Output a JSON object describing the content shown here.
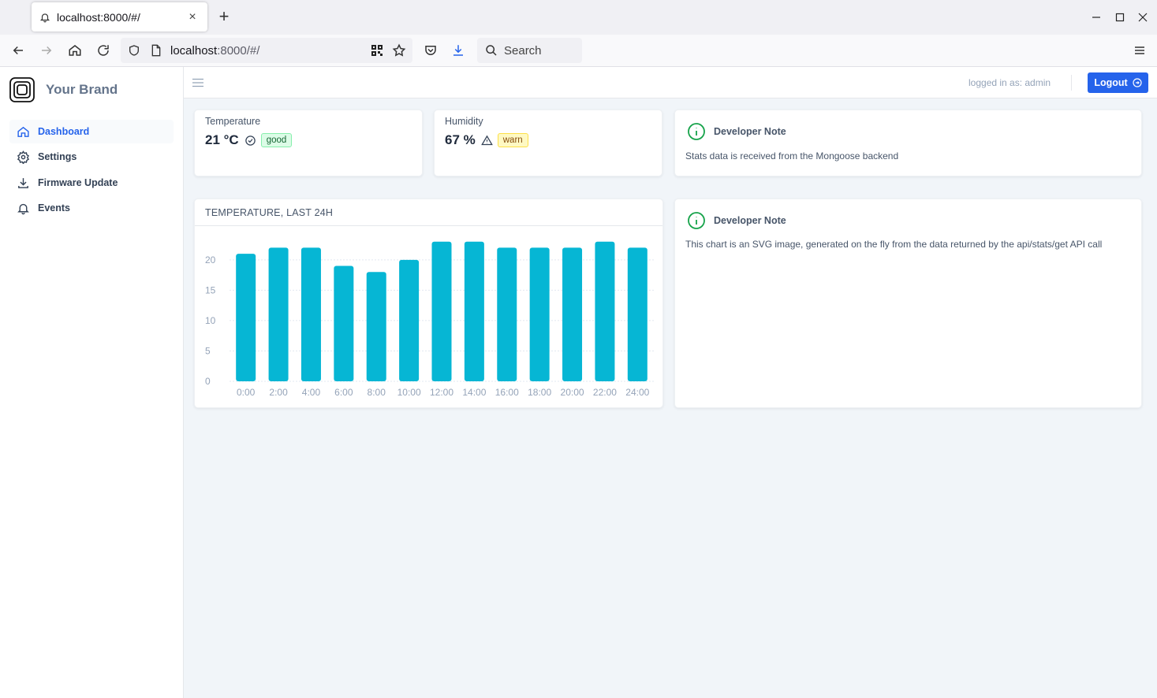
{
  "browser": {
    "tab_title": "localhost:8000/#/",
    "url_host": "localhost",
    "url_rest": ":8000/#/",
    "search_label": "Search"
  },
  "app": {
    "brand": "Your Brand",
    "nav": [
      {
        "label": "Dashboard",
        "icon": "home-icon",
        "active": true
      },
      {
        "label": "Settings",
        "icon": "gear-icon",
        "active": false
      },
      {
        "label": "Firmware Update",
        "icon": "download-icon",
        "active": false
      },
      {
        "label": "Events",
        "icon": "bell-icon",
        "active": false
      }
    ],
    "logged_in": "logged in as: admin",
    "logout_label": "Logout",
    "accent": "#2563eb"
  },
  "stats": {
    "temperature": {
      "label": "Temperature",
      "value": "21 °C",
      "badge": "good",
      "icon": "check-circle-icon"
    },
    "humidity": {
      "label": "Humidity",
      "value": "67 %",
      "badge": "warn",
      "icon": "warning-icon"
    }
  },
  "notes": [
    {
      "title": "Developer Note",
      "text": "Stats data is received from the Mongoose backend"
    },
    {
      "title": "Developer Note",
      "text": "This chart is an SVG image, generated on the fly from the data returned by the api/stats/get API call"
    }
  ],
  "chart_title": "TEMPERATURE, LAST 24H",
  "chart_data": {
    "type": "bar",
    "title": "TEMPERATURE, LAST 24H",
    "categories": [
      "0:00",
      "2:00",
      "4:00",
      "6:00",
      "8:00",
      "10:00",
      "12:00",
      "14:00",
      "16:00",
      "18:00",
      "20:00",
      "22:00",
      "24:00"
    ],
    "values": [
      21,
      22,
      22,
      19,
      18,
      20,
      23,
      23,
      22,
      22,
      22,
      23,
      22
    ],
    "yticks": [
      0,
      5,
      10,
      15,
      20
    ],
    "ylim": [
      0,
      24
    ],
    "grid": true,
    "color": "#06b6d4"
  }
}
